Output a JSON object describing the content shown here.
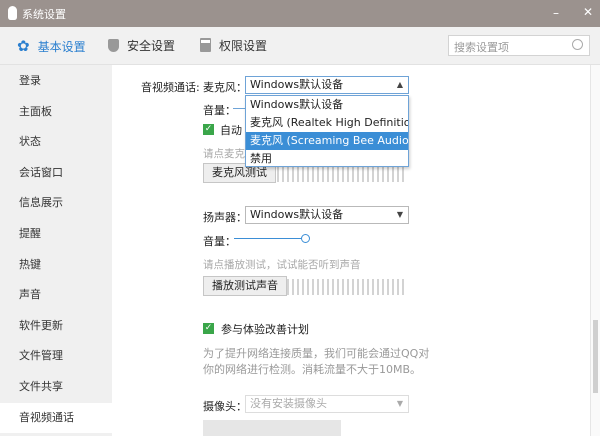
{
  "window": {
    "title": "系统设置",
    "minimize": "–",
    "close": "✕"
  },
  "toolbar": {
    "tabs": [
      {
        "label": "基本设置",
        "icon": "gear-icon"
      },
      {
        "label": "安全设置",
        "icon": "shield-icon"
      },
      {
        "label": "权限设置",
        "icon": "lock-icon"
      }
    ],
    "search_placeholder": "搜索设置项"
  },
  "sidebar": {
    "items": [
      "登录",
      "主面板",
      "状态",
      "会话窗口",
      "信息展示",
      "提醒",
      "热键",
      "声音",
      "软件更新",
      "文件管理",
      "文件共享",
      "音视频通话"
    ],
    "selected": "音视频通话"
  },
  "main": {
    "section_label": "音视频通话:",
    "mic": {
      "label": "麦克风：",
      "value": "Windows默认设备",
      "options": [
        "Windows默认设备",
        "麦克风 (Realtek High Definition",
        "麦克风 (Screaming Bee Audio)",
        "禁用"
      ],
      "highlighted": "麦克风 (Screaming Bee Audio)",
      "volume_label": "音量：",
      "auto_label": "自动",
      "hint": "请点麦克",
      "test_button": "麦克风测试"
    },
    "speaker": {
      "label": "扬声器：",
      "value": "Windows默认设备",
      "volume_label": "音量：",
      "volume_fraction": 0.95,
      "hint": "请点播放测试，试试能否听到声音",
      "test_button": "播放测试声音"
    },
    "improve": {
      "label": "参与体验改善计划",
      "checked": true,
      "desc1": "为了提升网络连接质量，我们可能会通过QQ对",
      "desc2": "你的网络进行检测。消耗流量不大于10MB。"
    },
    "camera": {
      "label": "摄像头：",
      "value": "没有安装摄像头"
    }
  },
  "colors": {
    "accent": "#3b8ed6",
    "titlebar": "#9b928e",
    "check": "#3aa64a"
  }
}
